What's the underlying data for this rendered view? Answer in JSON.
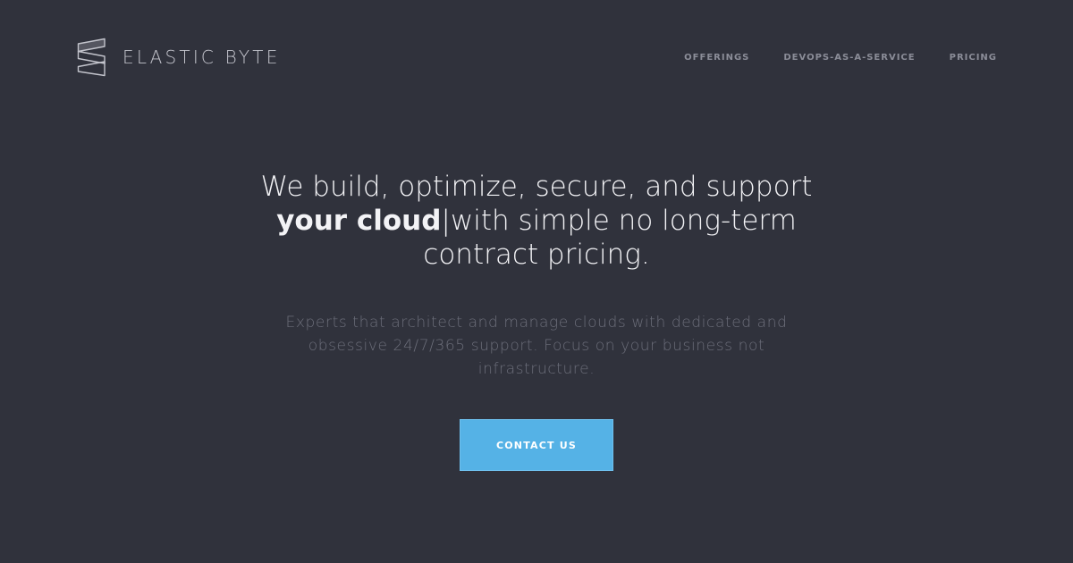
{
  "brand": {
    "name": "ELASTIC BYTE",
    "logo_icon": "elastic-byte-logo-icon"
  },
  "nav": {
    "items": [
      {
        "label": "OFFERINGS"
      },
      {
        "label": "DEVOPS-AS-A-SERVICE"
      },
      {
        "label": "PRICING"
      }
    ]
  },
  "hero": {
    "headline_part1": "We build, optimize, secure, and support ",
    "headline_strong": "your cloud",
    "headline_cursor": "|",
    "headline_part2": "with simple no long-term contract pricing.",
    "subtext": "Experts that architect and manage clouds with dedicated and obsessive 24/7/365 support. Focus on your business not infrastructure.",
    "cta_label": "CONTACT US"
  },
  "colors": {
    "background": "#30323c",
    "accent": "#55b2e6",
    "headline_text": "#f3f3f6",
    "subtext": "#6c6e7a",
    "nav_text": "#8b8d98"
  }
}
